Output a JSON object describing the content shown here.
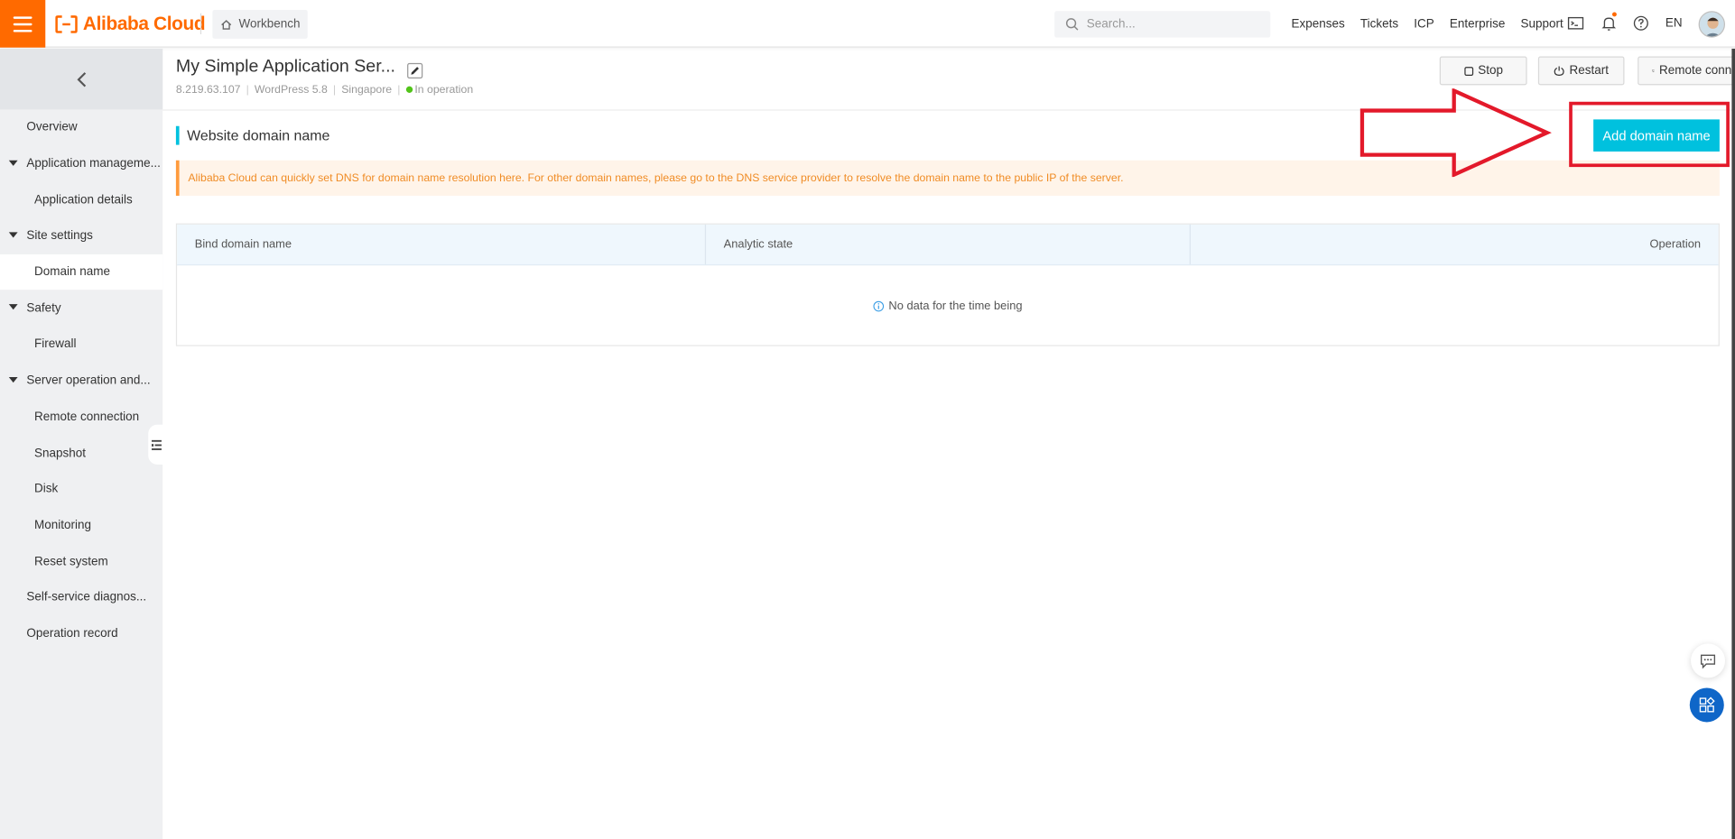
{
  "brand": {
    "name": "Alibaba Cloud",
    "accent": "#ff6a00"
  },
  "topbar": {
    "workbench_label": "Workbench",
    "search_placeholder": "Search...",
    "links": [
      "Expenses",
      "Tickets",
      "ICP",
      "Enterprise",
      "Support"
    ],
    "language": "EN",
    "icons": [
      "terminal-icon",
      "bell-icon",
      "help-icon"
    ]
  },
  "sidebar": {
    "items": [
      {
        "label": "Overview",
        "level": 0
      },
      {
        "label": "Application manageme...",
        "level": 0,
        "expanded": true
      },
      {
        "label": "Application details",
        "level": 1
      },
      {
        "label": "Site settings",
        "level": 0,
        "expanded": true
      },
      {
        "label": "Domain name",
        "level": 1,
        "active": true
      },
      {
        "label": "Safety",
        "level": 0,
        "expanded": true
      },
      {
        "label": "Firewall",
        "level": 1
      },
      {
        "label": "Server operation and...",
        "level": 0,
        "expanded": true
      },
      {
        "label": "Remote connection",
        "level": 1
      },
      {
        "label": "Snapshot",
        "level": 1
      },
      {
        "label": "Disk",
        "level": 1
      },
      {
        "label": "Monitoring",
        "level": 1
      },
      {
        "label": "Reset system",
        "level": 1
      },
      {
        "label": "Self-service diagnos...",
        "level": 0
      },
      {
        "label": "Operation record",
        "level": 0
      }
    ]
  },
  "header": {
    "title": "My Simple Application Ser...",
    "ip": "8.219.63.107",
    "image": "WordPress 5.8",
    "region": "Singapore",
    "status": "In operation",
    "status_color": "#52c41a",
    "buttons": {
      "stop": "Stop",
      "restart": "Restart",
      "remote": "Remote conne"
    }
  },
  "main": {
    "section_title": "Website domain name",
    "add_button": "Add domain name",
    "notice": "Alibaba Cloud can quickly set DNS for domain name resolution here. For other domain names, please go to the DNS service provider to resolve the domain name to the public IP of the server.",
    "table": {
      "columns": [
        "Bind domain name",
        "Analytic state",
        "Operation"
      ],
      "empty_text": "No data for the time being"
    }
  }
}
